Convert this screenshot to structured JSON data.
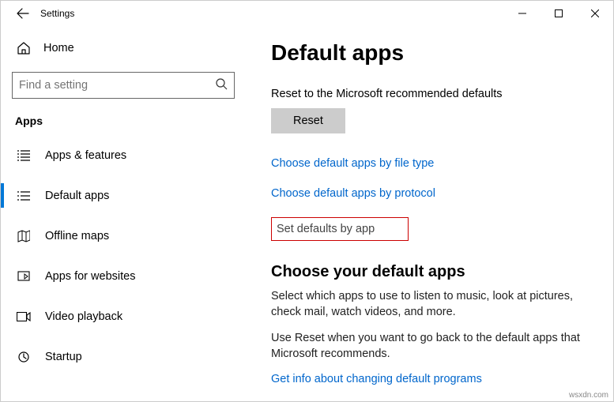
{
  "window": {
    "title": "Settings"
  },
  "sidebar": {
    "home": "Home",
    "search_placeholder": "Find a setting",
    "section": "Apps",
    "items": [
      {
        "label": "Apps & features"
      },
      {
        "label": "Default apps"
      },
      {
        "label": "Offline maps"
      },
      {
        "label": "Apps for websites"
      },
      {
        "label": "Video playback"
      },
      {
        "label": "Startup"
      }
    ]
  },
  "main": {
    "heading": "Default apps",
    "reset_label": "Reset to the Microsoft recommended defaults",
    "reset_button": "Reset",
    "link_filetype": "Choose default apps by file type",
    "link_protocol": "Choose default apps by protocol",
    "link_byapp": "Set defaults by app",
    "choose_heading": "Choose your default apps",
    "choose_desc1": "Select which apps to use to listen to music, look at pictures, check mail, watch videos, and more.",
    "choose_desc2": "Use Reset when you want to go back to the default apps that Microsoft recommends.",
    "link_info": "Get info about changing default programs"
  },
  "watermark": "wsxdn.com"
}
